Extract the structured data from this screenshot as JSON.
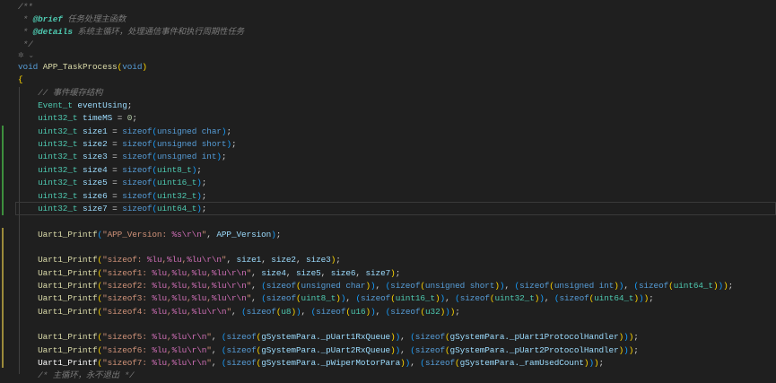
{
  "editor": {
    "lines": [
      [
        [
          "c",
          "/**"
        ]
      ],
      [
        [
          "c",
          " * "
        ],
        [
          "tag",
          "@brief"
        ],
        [
          "c",
          " 任务处理主函数"
        ]
      ],
      [
        [
          "c",
          " * "
        ],
        [
          "tag",
          "@details"
        ],
        [
          "c",
          " 系统主循环，处理通信事件和执行周期性任务"
        ]
      ],
      [
        [
          "c",
          " */"
        ]
      ],
      [
        [
          "lens",
          "✲ ⌄"
        ]
      ],
      [
        [
          "k",
          "void"
        ],
        [
          "p",
          " "
        ],
        [
          "f",
          "APP_TaskProcess"
        ],
        [
          "b1",
          "("
        ],
        [
          "k",
          "void"
        ],
        [
          "b1",
          ")"
        ]
      ],
      [
        [
          "b1",
          "{"
        ]
      ],
      [
        [
          "c",
          "    // 事件缓存结构"
        ]
      ],
      [
        [
          "p",
          "    "
        ],
        [
          "t",
          "Event_t"
        ],
        [
          "p",
          " "
        ],
        [
          "v",
          "eventUsing"
        ],
        [
          "p",
          ";"
        ]
      ],
      [
        [
          "p",
          "    "
        ],
        [
          "t",
          "uint32_t"
        ],
        [
          "p",
          " "
        ],
        [
          "v",
          "timeMS"
        ],
        [
          "p",
          " = "
        ],
        [
          "n",
          "0"
        ],
        [
          "p",
          ";"
        ]
      ],
      [
        [
          "p",
          "    "
        ],
        [
          "t",
          "uint32_t"
        ],
        [
          "p",
          " "
        ],
        [
          "v",
          "size1"
        ],
        [
          "p",
          " = "
        ],
        [
          "k",
          "sizeof"
        ],
        [
          "b2",
          "("
        ],
        [
          "k",
          "unsigned char"
        ],
        [
          "b2",
          ")"
        ],
        [
          "p",
          ";"
        ]
      ],
      [
        [
          "p",
          "    "
        ],
        [
          "t",
          "uint32_t"
        ],
        [
          "p",
          " "
        ],
        [
          "v",
          "size2"
        ],
        [
          "p",
          " = "
        ],
        [
          "k",
          "sizeof"
        ],
        [
          "b2",
          "("
        ],
        [
          "k",
          "unsigned short"
        ],
        [
          "b2",
          ")"
        ],
        [
          "p",
          ";"
        ]
      ],
      [
        [
          "p",
          "    "
        ],
        [
          "t",
          "uint32_t"
        ],
        [
          "p",
          " "
        ],
        [
          "v",
          "size3"
        ],
        [
          "p",
          " = "
        ],
        [
          "k",
          "sizeof"
        ],
        [
          "b2",
          "("
        ],
        [
          "k",
          "unsigned int"
        ],
        [
          "b2",
          ")"
        ],
        [
          "p",
          ";"
        ]
      ],
      [
        [
          "p",
          "    "
        ],
        [
          "t",
          "uint32_t"
        ],
        [
          "p",
          " "
        ],
        [
          "v",
          "size4"
        ],
        [
          "p",
          " = "
        ],
        [
          "k",
          "sizeof"
        ],
        [
          "b2",
          "("
        ],
        [
          "t",
          "uint8_t"
        ],
        [
          "b2",
          ")"
        ],
        [
          "p",
          ";"
        ]
      ],
      [
        [
          "p",
          "    "
        ],
        [
          "t",
          "uint32_t"
        ],
        [
          "p",
          " "
        ],
        [
          "v",
          "size5"
        ],
        [
          "p",
          " = "
        ],
        [
          "k",
          "sizeof"
        ],
        [
          "b2",
          "("
        ],
        [
          "t",
          "uint16_t"
        ],
        [
          "b2",
          ")"
        ],
        [
          "p",
          ";"
        ]
      ],
      [
        [
          "p",
          "    "
        ],
        [
          "t",
          "uint32_t"
        ],
        [
          "p",
          " "
        ],
        [
          "v",
          "size6"
        ],
        [
          "p",
          " = "
        ],
        [
          "k",
          "sizeof"
        ],
        [
          "b2",
          "("
        ],
        [
          "t",
          "uint32_t"
        ],
        [
          "b2",
          ")"
        ],
        [
          "p",
          ";"
        ]
      ],
      [
        [
          "p",
          "    "
        ],
        [
          "t",
          "uint32_t"
        ],
        [
          "p",
          " "
        ],
        [
          "v",
          "size7"
        ],
        [
          "p",
          " = "
        ],
        [
          "k",
          "sizeof"
        ],
        [
          "b2",
          "("
        ],
        [
          "t",
          "uint64_t"
        ],
        [
          "b2",
          ")"
        ],
        [
          "p",
          ";"
        ]
      ],
      [],
      [
        [
          "p",
          "    "
        ],
        [
          "f",
          "Uart1_Printf"
        ],
        [
          "b2",
          "("
        ],
        [
          "s",
          "\"APP_Version: "
        ],
        [
          "e",
          "%s\\r\\n"
        ],
        [
          "s",
          "\""
        ],
        [
          "p",
          ", "
        ],
        [
          "v",
          "APP_Version"
        ],
        [
          "b2",
          ")"
        ],
        [
          "p",
          ";"
        ]
      ],
      [],
      [
        [
          "p",
          "    "
        ],
        [
          "f",
          "Uart1_Printf"
        ],
        [
          "b1",
          "("
        ],
        [
          "s",
          "\"sizeof: "
        ],
        [
          "e",
          "%lu"
        ],
        [
          "s",
          ","
        ],
        [
          "e",
          "%lu"
        ],
        [
          "s",
          ","
        ],
        [
          "e",
          "%lu\\r\\n"
        ],
        [
          "s",
          "\""
        ],
        [
          "p",
          ", "
        ],
        [
          "v",
          "size1"
        ],
        [
          "p",
          ", "
        ],
        [
          "v",
          "size2"
        ],
        [
          "p",
          ", "
        ],
        [
          "v",
          "size3"
        ],
        [
          "b1",
          ")"
        ],
        [
          "p",
          ";"
        ]
      ],
      [
        [
          "p",
          "    "
        ],
        [
          "f",
          "Uart1_Printf"
        ],
        [
          "b1",
          "("
        ],
        [
          "s",
          "\"sizeof1: "
        ],
        [
          "e",
          "%lu"
        ],
        [
          "s",
          ","
        ],
        [
          "e",
          "%lu"
        ],
        [
          "s",
          ","
        ],
        [
          "e",
          "%lu"
        ],
        [
          "s",
          ","
        ],
        [
          "e",
          "%lu\\r\\n"
        ],
        [
          "s",
          "\""
        ],
        [
          "p",
          ", "
        ],
        [
          "v",
          "size4"
        ],
        [
          "p",
          ", "
        ],
        [
          "v",
          "size5"
        ],
        [
          "p",
          ", "
        ],
        [
          "v",
          "size6"
        ],
        [
          "p",
          ", "
        ],
        [
          "v",
          "size7"
        ],
        [
          "b1",
          ")"
        ],
        [
          "p",
          ";"
        ]
      ],
      [
        [
          "p",
          "    "
        ],
        [
          "f",
          "Uart1_Printf"
        ],
        [
          "b1",
          "("
        ],
        [
          "s",
          "\"sizeof2: "
        ],
        [
          "e",
          "%lu"
        ],
        [
          "s",
          ","
        ],
        [
          "e",
          "%lu"
        ],
        [
          "s",
          ","
        ],
        [
          "e",
          "%lu"
        ],
        [
          "s",
          ","
        ],
        [
          "e",
          "%lu\\r\\n"
        ],
        [
          "s",
          "\""
        ],
        [
          "p",
          ", "
        ],
        [
          "b2",
          "("
        ],
        [
          "k",
          "sizeof"
        ],
        [
          "b1",
          "("
        ],
        [
          "k",
          "unsigned char"
        ],
        [
          "b1",
          ")"
        ],
        [
          "b2",
          ")"
        ],
        [
          "p",
          ", "
        ],
        [
          "b2",
          "("
        ],
        [
          "k",
          "sizeof"
        ],
        [
          "b1",
          "("
        ],
        [
          "k",
          "unsigned short"
        ],
        [
          "b1",
          ")"
        ],
        [
          "b2",
          ")"
        ],
        [
          "p",
          ", "
        ],
        [
          "b2",
          "("
        ],
        [
          "k",
          "sizeof"
        ],
        [
          "b1",
          "("
        ],
        [
          "k",
          "unsigned int"
        ],
        [
          "b1",
          ")"
        ],
        [
          "b2",
          ")"
        ],
        [
          "p",
          ", "
        ],
        [
          "b2",
          "("
        ],
        [
          "k",
          "sizeof"
        ],
        [
          "b1",
          "("
        ],
        [
          "t",
          "uint64_t"
        ],
        [
          "b1",
          ")"
        ],
        [
          "b2",
          ")"
        ],
        [
          "b1",
          ")"
        ],
        [
          "p",
          ";"
        ]
      ],
      [
        [
          "p",
          "    "
        ],
        [
          "f",
          "Uart1_Printf"
        ],
        [
          "b1",
          "("
        ],
        [
          "s",
          "\"sizeof3: "
        ],
        [
          "e",
          "%lu"
        ],
        [
          "s",
          ","
        ],
        [
          "e",
          "%lu"
        ],
        [
          "s",
          ","
        ],
        [
          "e",
          "%lu"
        ],
        [
          "s",
          ","
        ],
        [
          "e",
          "%lu\\r\\n"
        ],
        [
          "s",
          "\""
        ],
        [
          "p",
          ", "
        ],
        [
          "b2",
          "("
        ],
        [
          "k",
          "sizeof"
        ],
        [
          "b1",
          "("
        ],
        [
          "t",
          "uint8_t"
        ],
        [
          "b1",
          ")"
        ],
        [
          "b2",
          ")"
        ],
        [
          "p",
          ", "
        ],
        [
          "b2",
          "("
        ],
        [
          "k",
          "sizeof"
        ],
        [
          "b1",
          "("
        ],
        [
          "t",
          "uint16_t"
        ],
        [
          "b1",
          ")"
        ],
        [
          "b2",
          ")"
        ],
        [
          "p",
          ", "
        ],
        [
          "b2",
          "("
        ],
        [
          "k",
          "sizeof"
        ],
        [
          "b1",
          "("
        ],
        [
          "t",
          "uint32_t"
        ],
        [
          "b1",
          ")"
        ],
        [
          "b2",
          ")"
        ],
        [
          "p",
          ", "
        ],
        [
          "b2",
          "("
        ],
        [
          "k",
          "sizeof"
        ],
        [
          "b1",
          "("
        ],
        [
          "t",
          "uint64_t"
        ],
        [
          "b1",
          ")"
        ],
        [
          "b2",
          ")"
        ],
        [
          "b1",
          ")"
        ],
        [
          "p",
          ";"
        ]
      ],
      [
        [
          "p",
          "    "
        ],
        [
          "f",
          "Uart1_Printf"
        ],
        [
          "b1",
          "("
        ],
        [
          "s",
          "\"sizeof4: "
        ],
        [
          "e",
          "%lu"
        ],
        [
          "s",
          ","
        ],
        [
          "e",
          "%lu"
        ],
        [
          "s",
          ","
        ],
        [
          "e",
          "%lu\\r\\n"
        ],
        [
          "s",
          "\""
        ],
        [
          "p",
          ", "
        ],
        [
          "b2",
          "("
        ],
        [
          "k",
          "sizeof"
        ],
        [
          "b1",
          "("
        ],
        [
          "t",
          "u8"
        ],
        [
          "b1",
          ")"
        ],
        [
          "b2",
          ")"
        ],
        [
          "p",
          ", "
        ],
        [
          "b2",
          "("
        ],
        [
          "k",
          "sizeof"
        ],
        [
          "b1",
          "("
        ],
        [
          "t",
          "u16"
        ],
        [
          "b1",
          ")"
        ],
        [
          "b2",
          ")"
        ],
        [
          "p",
          ", "
        ],
        [
          "b2",
          "("
        ],
        [
          "k",
          "sizeof"
        ],
        [
          "b1",
          "("
        ],
        [
          "t",
          "u32"
        ],
        [
          "b1",
          ")"
        ],
        [
          "b2",
          ")"
        ],
        [
          "b1",
          ")"
        ],
        [
          "p",
          ";"
        ]
      ],
      [],
      [
        [
          "p",
          "    "
        ],
        [
          "f",
          "Uart1_Printf"
        ],
        [
          "b1",
          "("
        ],
        [
          "s",
          "\"sizeof5: "
        ],
        [
          "e",
          "%lu"
        ],
        [
          "s",
          ","
        ],
        [
          "e",
          "%lu\\r\\n"
        ],
        [
          "s",
          "\""
        ],
        [
          "p",
          ", "
        ],
        [
          "b2",
          "("
        ],
        [
          "k",
          "sizeof"
        ],
        [
          "b1",
          "("
        ],
        [
          "v",
          "gSystemPara._pUart1RxQueue"
        ],
        [
          "b1",
          ")"
        ],
        [
          "b2",
          ")"
        ],
        [
          "p",
          ", "
        ],
        [
          "b2",
          "("
        ],
        [
          "k",
          "sizeof"
        ],
        [
          "b1",
          "("
        ],
        [
          "v",
          "gSystemPara._pUart1ProtocolHandler"
        ],
        [
          "b1",
          ")"
        ],
        [
          "b2",
          ")"
        ],
        [
          "b1",
          ")"
        ],
        [
          "p",
          ";"
        ]
      ],
      [
        [
          "p",
          "    "
        ],
        [
          "f",
          "Uart1_Printf"
        ],
        [
          "b1",
          "("
        ],
        [
          "s",
          "\"sizeof6: "
        ],
        [
          "e",
          "%lu"
        ],
        [
          "s",
          ","
        ],
        [
          "e",
          "%lu\\r\\n"
        ],
        [
          "s",
          "\""
        ],
        [
          "p",
          ", "
        ],
        [
          "b2",
          "("
        ],
        [
          "k",
          "sizeof"
        ],
        [
          "b1",
          "("
        ],
        [
          "v",
          "gSystemPara._pUart2RxQueue"
        ],
        [
          "b1",
          ")"
        ],
        [
          "b2",
          ")"
        ],
        [
          "p",
          ", "
        ],
        [
          "b2",
          "("
        ],
        [
          "k",
          "sizeof"
        ],
        [
          "b1",
          "("
        ],
        [
          "v",
          "gSystemPara._pUart2ProtocolHandler"
        ],
        [
          "b1",
          ")"
        ],
        [
          "b2",
          ")"
        ],
        [
          "b1",
          ")"
        ],
        [
          "p",
          ";"
        ]
      ],
      [
        [
          "p",
          "    "
        ],
        [
          "w",
          "Uart1_Printf"
        ],
        [
          "b1",
          "("
        ],
        [
          "s",
          "\"sizeof7: "
        ],
        [
          "e",
          "%lu"
        ],
        [
          "s",
          ","
        ],
        [
          "e",
          "%lu\\r\\n"
        ],
        [
          "s",
          "\""
        ],
        [
          "p",
          ", "
        ],
        [
          "b2",
          "("
        ],
        [
          "k",
          "sizeof"
        ],
        [
          "b1",
          "("
        ],
        [
          "v",
          "gSystemPara._pWiperMotorPara"
        ],
        [
          "b1",
          ")"
        ],
        [
          "b2",
          ")"
        ],
        [
          "p",
          ", "
        ],
        [
          "b2",
          "("
        ],
        [
          "k",
          "sizeof"
        ],
        [
          "b1",
          "("
        ],
        [
          "v",
          "gSystemPara._ramUsedCount"
        ],
        [
          "b1",
          ")"
        ],
        [
          "b2",
          ")"
        ],
        [
          "b1",
          ")"
        ],
        [
          "p",
          ";"
        ]
      ],
      [
        [
          "c",
          "    /* 主循环，永不退出 */"
        ]
      ]
    ],
    "current_line": 16,
    "colors": {
      "background": "#1f1f1f",
      "added_gutter": "#3d8f3d",
      "modified_gutter": "#9b8a3a"
    }
  }
}
